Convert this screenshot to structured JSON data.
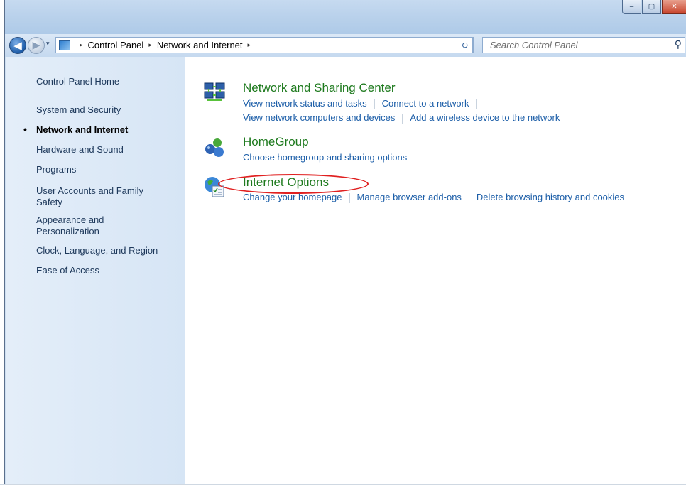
{
  "window": {
    "caption_buttons": {
      "minimize": "‒",
      "maximize": "▢",
      "close": "✕"
    }
  },
  "navbar": {
    "back_glyph": "◀",
    "forward_glyph": "▶",
    "breadcrumb": [
      "Control Panel",
      "Network and Internet"
    ],
    "breadcrumb_separator": "▸",
    "dropdown_glyph": "▾",
    "refresh_glyph": "↻",
    "search_placeholder": "Search Control Panel",
    "search_glyph": "⚲"
  },
  "sidebar": {
    "items": [
      {
        "label": "Control Panel Home",
        "active": false
      },
      {
        "label": "System and Security",
        "active": false
      },
      {
        "label": "Network and Internet",
        "active": true
      },
      {
        "label": "Hardware and Sound",
        "active": false
      },
      {
        "label": "Programs",
        "active": false
      },
      {
        "label": "User Accounts and Family Safety",
        "active": false
      },
      {
        "label": "Appearance and Personalization",
        "active": false
      },
      {
        "label": "Clock, Language, and Region",
        "active": false
      },
      {
        "label": "Ease of Access",
        "active": false
      }
    ],
    "bullet": "•"
  },
  "categories": [
    {
      "title": "Network and Sharing Center",
      "icon": "network-sharing-icon",
      "links": [
        [
          "View network status and tasks",
          "Connect to a network"
        ],
        [
          "View network computers and devices",
          "Add a wireless device to the network"
        ]
      ]
    },
    {
      "title": "HomeGroup",
      "icon": "homegroup-icon",
      "links": [
        [
          "Choose homegroup and sharing options"
        ]
      ]
    },
    {
      "title": "Internet Options",
      "icon": "internet-options-icon",
      "links": [
        [
          "Change your homepage",
          "Manage browser add-ons",
          "Delete browsing history and cookies"
        ]
      ]
    }
  ],
  "colors": {
    "category_title": "#1e7a1e",
    "link": "#1c5ea8",
    "highlight": "#e02020",
    "sidebar_bg": "#d6e5f5"
  }
}
